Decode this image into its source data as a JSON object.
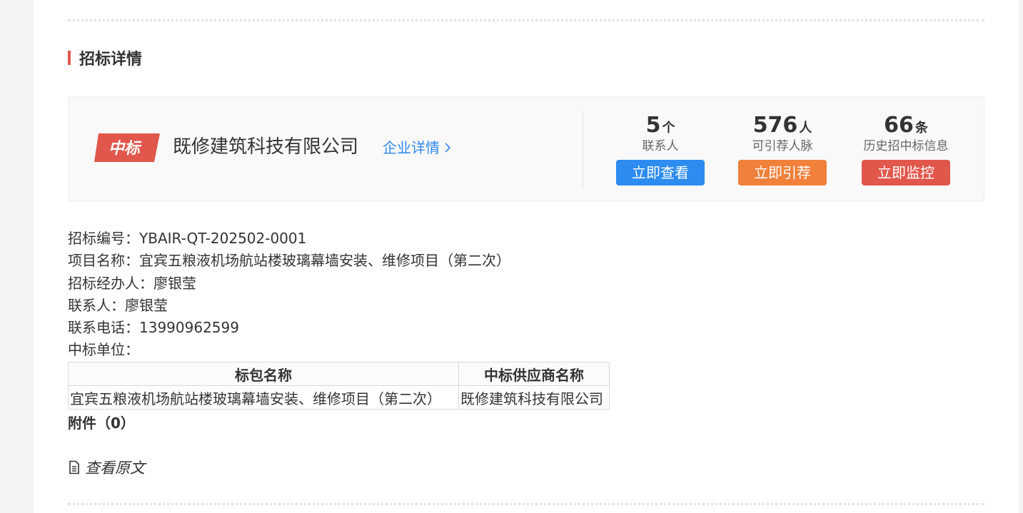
{
  "section": {
    "title": "招标详情"
  },
  "winner": {
    "badge": "中标",
    "company": "既修建筑科技有限公司",
    "detail_link": "企业详情",
    "stats": [
      {
        "value": "5",
        "unit": "个",
        "label": "联系人",
        "button": "立即查看",
        "color": "#2d8cf0"
      },
      {
        "value": "576",
        "unit": "人",
        "label": "可引荐人脉",
        "button": "立即引荐",
        "color": "#f0803a"
      },
      {
        "value": "66",
        "unit": "条",
        "label": "历史招中标信息",
        "button": "立即监控",
        "color": "#e2574c"
      }
    ]
  },
  "info": {
    "bid_no_label": "招标编号：",
    "bid_no": "YBAIR-QT-202502-0001",
    "project_label": "项目名称：",
    "project": "宜宾五粮液机场航站楼玻璃幕墙安装、维修项目（第二次）",
    "handler_label": "招标经办人：",
    "handler": "廖银莹",
    "contact_label": "联系人：",
    "contact": "廖银莹",
    "phone_label": "联系电话：",
    "phone": "13990962599",
    "winner_unit_label": "中标单位："
  },
  "award_table": {
    "headers": [
      "标包名称",
      "中标供应商名称"
    ],
    "rows": [
      [
        "宜宾五粮液机场航站楼玻璃幕墙安装、维修项目（第二次）",
        "既修建筑科技有限公司"
      ]
    ]
  },
  "attachments": {
    "label": "附件（0）"
  },
  "view_original": {
    "label": "查看原文",
    "icon": "document-icon"
  },
  "colors": {
    "accent": "#e2574c",
    "link": "#2f88f0"
  }
}
